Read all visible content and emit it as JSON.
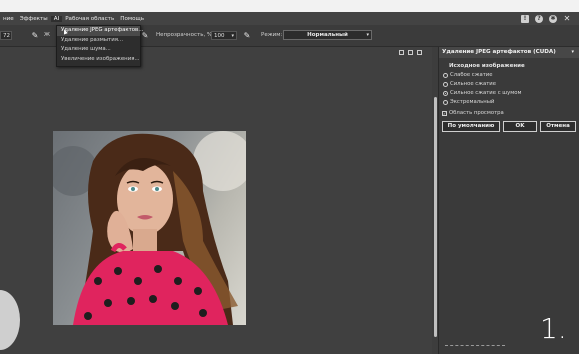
{
  "menubar": {
    "items": [
      "ние",
      "Эффекты",
      "AI",
      "Рабочая область",
      "Помощь"
    ],
    "active_index": 2
  },
  "toolbar": {
    "size_value": "72",
    "size_partial_label": "Ж",
    "opacity_label": "Непрозрачность, %",
    "opacity_value": "100",
    "mode_label": "Режим:",
    "mode_value": "Нормальный"
  },
  "dropdown": {
    "items": [
      "Удаление JPEG артефактов...",
      "Удаление размытия...",
      "Удаление шума...",
      "Увеличение изображения..."
    ],
    "highlighted_index": 0
  },
  "panel": {
    "title": "Удаление JPEG артефактов (CUDA)",
    "group_title": "Исходное изображение",
    "options": [
      "Слабое сжатие",
      "Сильное сжатие",
      "Сильное сжатие с шумом",
      "Экстремальный"
    ],
    "selected_index": 2,
    "preview_label": "Область просмотра",
    "preview_checked": true,
    "buttons": {
      "default": "По умолчанию",
      "ok": "OK",
      "cancel": "Отмена"
    }
  },
  "overlay": {
    "corner_digit": "1."
  },
  "colors": {
    "accent_pink": "#e0245e",
    "panel_bg": "#3a3a3a",
    "canvas_bg": "#404040"
  }
}
